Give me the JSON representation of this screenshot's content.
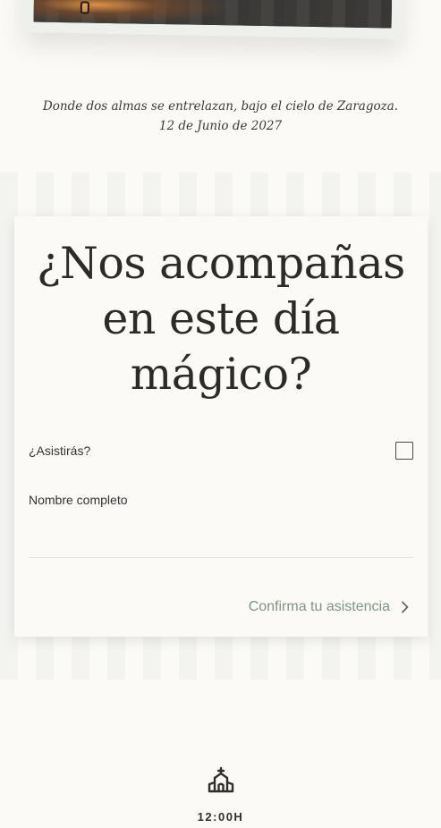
{
  "hero": {
    "tagline": "Donde dos almas se entrelazan, bajo el cielo de Zaragoza. 12 de Junio de 2027"
  },
  "rsvp": {
    "title": "¿Nos acompañas en este día mágico?",
    "attend_label": "¿Asistirás?",
    "attend_checked": false,
    "name_label": "Nombre completo",
    "name_value": "",
    "confirm_label": "Confirma tu asistencia",
    "accent_color": "#7f9584"
  },
  "schedule": {
    "icon": "church-icon",
    "time": "12:00H"
  }
}
